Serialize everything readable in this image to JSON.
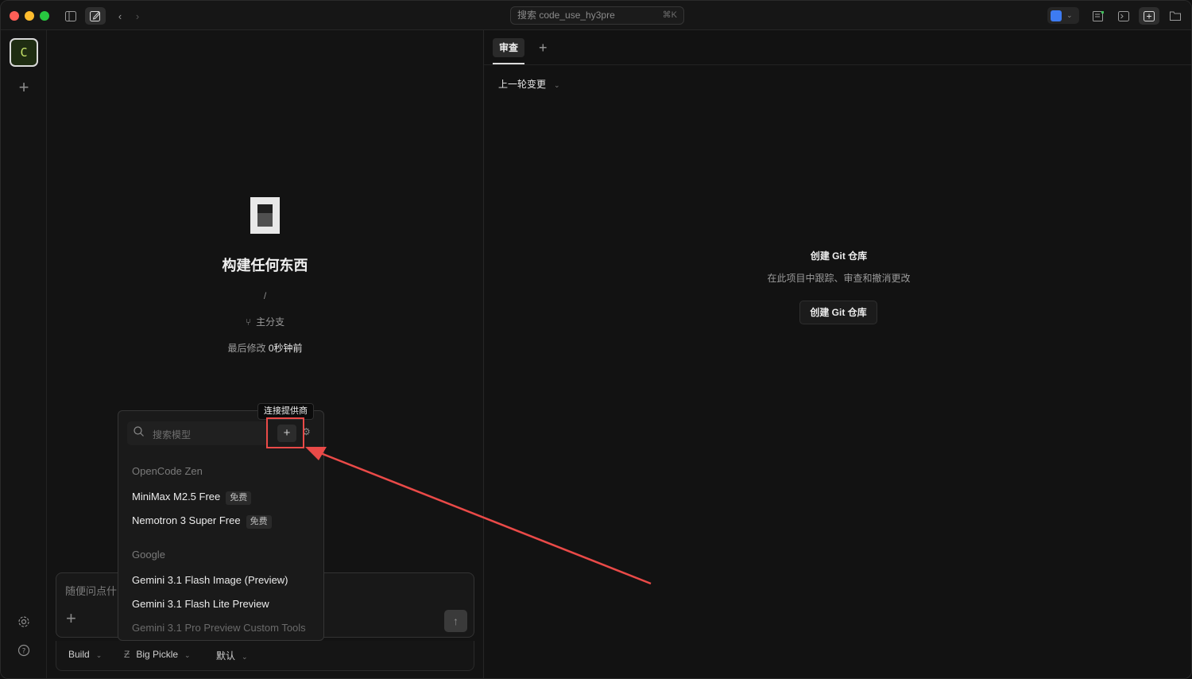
{
  "titlebar": {
    "search_text": "搜索 code_use_hy3pre",
    "search_shortcut": "⌘K"
  },
  "rail": {
    "project_initial": "C"
  },
  "center": {
    "hero_title": "构建任何东西",
    "path": "/",
    "branch": "主分支",
    "modified_label": "最后修改",
    "modified_value": "0秒钟前"
  },
  "composer": {
    "placeholder": "随便问点什",
    "agent": "Build",
    "model": "Big Pickle",
    "variant": "默认"
  },
  "model_picker": {
    "search_placeholder": "搜索模型",
    "tooltip": "连接提供商",
    "groups": [
      {
        "name": "OpenCode Zen",
        "models": [
          {
            "name": "MiniMax M2.5 Free",
            "badge": "免费"
          },
          {
            "name": "Nemotron 3 Super Free",
            "badge": "免费"
          }
        ]
      },
      {
        "name": "Google",
        "models": [
          {
            "name": "Gemini 3.1 Flash Image (Preview)"
          },
          {
            "name": "Gemini 3.1 Flash Lite Preview"
          },
          {
            "name": "Gemini 3.1 Pro Preview Custom Tools"
          }
        ]
      }
    ]
  },
  "review": {
    "tab_label": "审查",
    "changes_dropdown": "上一轮变更",
    "empty_title": "创建 Git 仓库",
    "empty_subtitle": "在此项目中跟踪、审查和撤消更改",
    "empty_button": "创建 Git 仓库"
  },
  "colors": {
    "annotation_red": "#ea4a48",
    "background": "#131313"
  }
}
